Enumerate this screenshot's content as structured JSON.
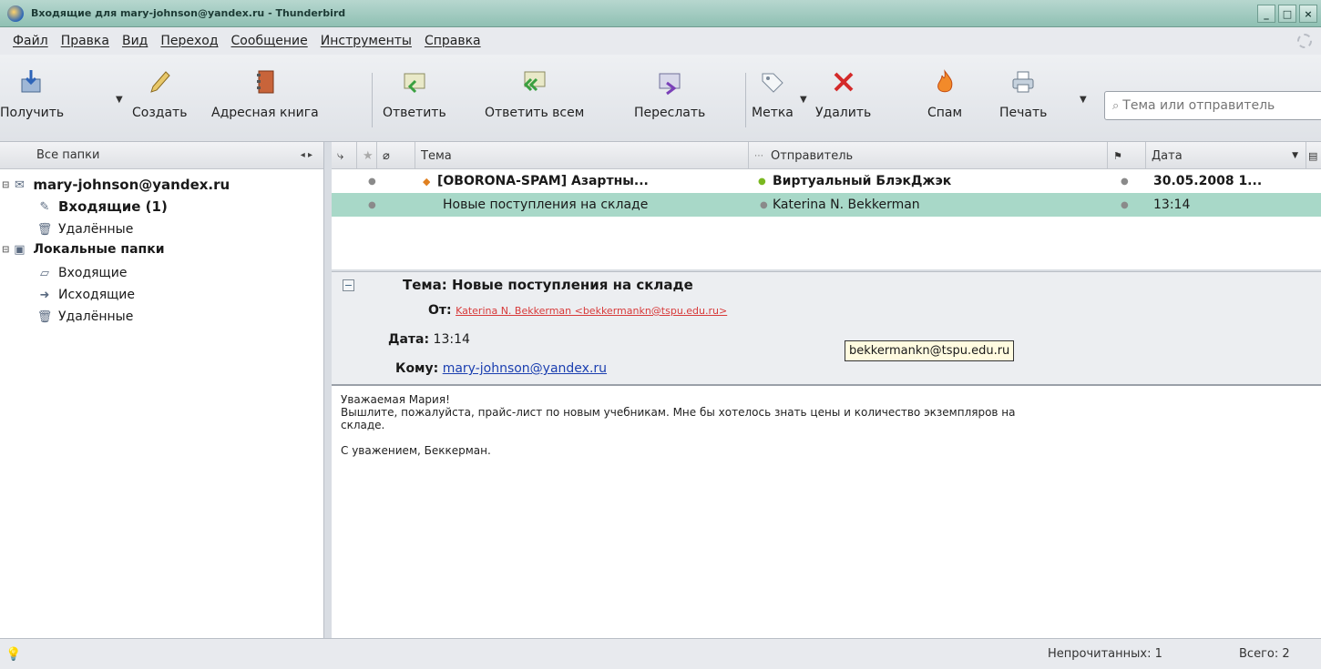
{
  "window": {
    "title": "Входящие для mary-johnson@yandex.ru - Thunderbird",
    "min_label": "_",
    "max_label": "□",
    "close_label": "×"
  },
  "menu": [
    "Файл",
    "Правка",
    "Вид",
    "Переход",
    "Сообщение",
    "Инструменты",
    "Справка"
  ],
  "toolbar": {
    "get": "Получить",
    "create": "Создать",
    "addressbook": "Адресная книга",
    "reply": "Ответить",
    "reply_all": "Ответить всем",
    "forward": "Переслать",
    "tag": "Метка",
    "delete": "Удалить",
    "spam": "Спам",
    "print": "Печать",
    "search_placeholder": "Тема или отправитель"
  },
  "folders": {
    "header": "Все папки",
    "account": "mary-johnson@yandex.ru",
    "inbox": "Входящие (1)",
    "trash": "Удалённые",
    "local": "Локальные папки",
    "local_inbox": "Входящие",
    "local_outbox": "Исходящие",
    "local_trash": "Удалённые"
  },
  "thread": {
    "columns": {
      "subject": "Тема",
      "sender": "Отправитель",
      "date": "Дата"
    },
    "rows": [
      {
        "subject": "[OBORONA-SPAM]  Азартны...",
        "sender": "Виртуальный БлэкДжэк",
        "date": "30.05.2008 1..."
      },
      {
        "subject": "Новые поступления на складе",
        "sender": "Katerina N. Bekkerman",
        "date": "13:14"
      }
    ]
  },
  "message": {
    "subject_label": "Тема:",
    "subject": "Новые поступления на складе",
    "from_label": "От:",
    "from": "Katerina N. Bekkerman <bekkermankn@tspu.edu.ru>",
    "date_label": "Дата:",
    "date": "13:14",
    "to_label": "Кому:",
    "to": "mary-johnson@yandex.ru",
    "tooltip": "bekkermankn@tspu.edu.ru",
    "body": [
      "Уважаемая Мария!",
      "Вышлите, пожалуйста, прайс-лист по новым учебникам. Мне бы хотелось знать цены и количество экземпляров на",
      "складе.",
      "",
      "С уважением, Беккерман."
    ]
  },
  "status": {
    "unread": "Непрочитанных: 1",
    "total": "Всего: 2"
  }
}
